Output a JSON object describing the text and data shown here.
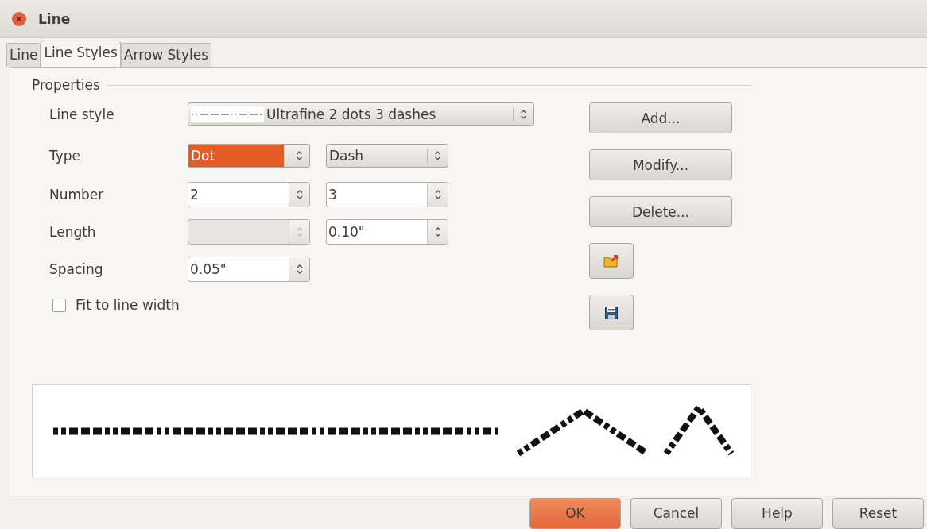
{
  "window": {
    "title": "Line"
  },
  "tabs": [
    {
      "label": "Line",
      "selected": false
    },
    {
      "label": "Line Styles",
      "selected": true
    },
    {
      "label": "Arrow Styles",
      "selected": false
    }
  ],
  "properties": {
    "title": "Properties",
    "line_style": {
      "label": "Line style",
      "value": "Ultrafine 2 dots 3 dashes"
    },
    "rows": [
      {
        "label": "Type",
        "kind": "dropdown",
        "fields": [
          {
            "value": "Dot",
            "highlighted": true
          },
          {
            "value": "Dash",
            "highlighted": false
          }
        ]
      },
      {
        "label": "Number",
        "kind": "spin",
        "fields": [
          {
            "value": "2",
            "disabled": false
          },
          {
            "value": "3",
            "disabled": false
          }
        ]
      },
      {
        "label": "Length",
        "kind": "spin",
        "fields": [
          {
            "disabled": true
          },
          {
            "value": "0.10\"",
            "disabled": false
          }
        ]
      },
      {
        "label": "Spacing",
        "kind": "spin",
        "fields": [
          {
            "value": "0.05\"",
            "disabled": false
          }
        ]
      }
    ],
    "fit_to_line_width": {
      "label": "Fit to line width",
      "checked": false
    }
  },
  "side_buttons": [
    {
      "kind": "text",
      "label": "Add..."
    },
    {
      "kind": "text",
      "label": "Modify..."
    },
    {
      "kind": "text",
      "label": "Delete..."
    },
    {
      "kind": "open"
    },
    {
      "kind": "save"
    }
  ],
  "footer_buttons": [
    {
      "label": "OK",
      "default": true
    },
    {
      "label": "Cancel",
      "default": false
    },
    {
      "label": "Help",
      "default": false
    },
    {
      "label": "Reset",
      "default": false
    }
  ]
}
